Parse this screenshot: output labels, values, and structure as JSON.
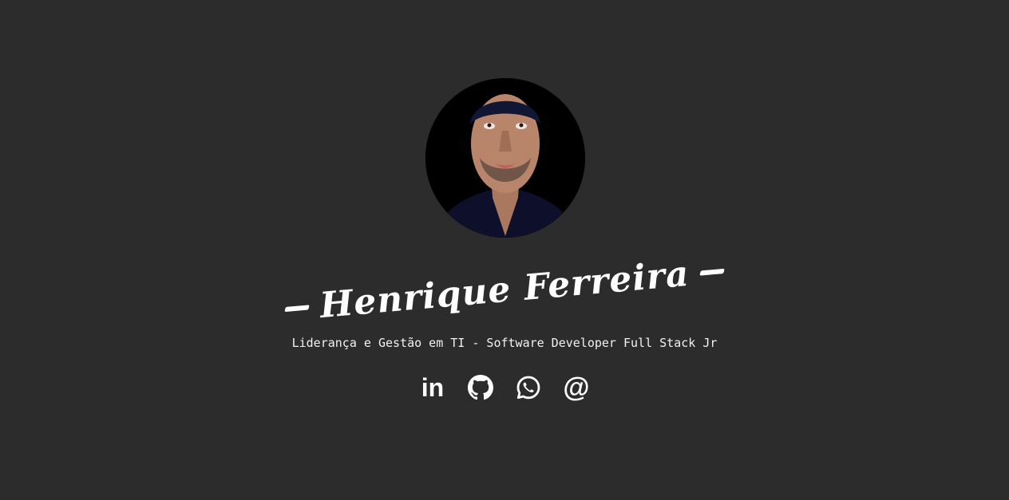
{
  "profile": {
    "name": "Henrique Ferreira",
    "subtitle": "Liderança e Gestão em TI - Software Developer Full Stack Jr"
  },
  "social": {
    "linkedin_glyph": "in",
    "email_glyph": "@",
    "icons": [
      "linkedin-icon",
      "github-icon",
      "whatsapp-icon",
      "email-icon"
    ]
  },
  "colors": {
    "background": "#2c2c2c",
    "text": "#ffffff"
  }
}
